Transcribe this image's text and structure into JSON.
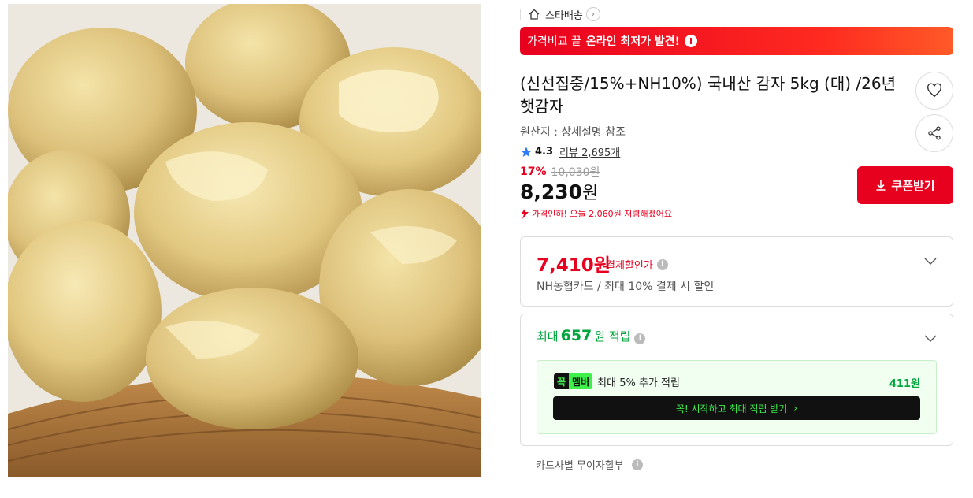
{
  "delivery": {
    "label": "스타배송",
    "chevron": "›"
  },
  "banner": {
    "prefix": "가격비교 끝",
    "highlight": "온라인 최저가 발견!",
    "info": "i"
  },
  "product": {
    "title": "(신선집중/15%+NH10%) 국내산 감자 5kg (대) /26년 햇감자",
    "origin": "원산지 : 상세설명 참조",
    "rating": "4.3",
    "review_text": "리뷰 2,695개",
    "discount_rate": "17%",
    "original_price": "10,030원",
    "price_number": "8,230",
    "price_unit": "원",
    "price_drop": "가격인하! 오늘 2,060원 저렴해졌어요"
  },
  "coupon_button": {
    "label": "쿠폰받기"
  },
  "payment_discount": {
    "price": "7,410원",
    "label": "결제할인가",
    "info": "i",
    "desc": "NH농협카드 / 최대 10% 결제 시 할인"
  },
  "points": {
    "prefix": "최대",
    "amount": "657",
    "suffix": "원 적립",
    "info": "i",
    "member": {
      "badge_a": "꼭",
      "badge_b": "멤버",
      "text": "최대 5% 추가 적립",
      "points": "411원",
      "cta": "꼭! 시작하고 최대 적립 받기",
      "cta_chevron": "›"
    }
  },
  "installment": {
    "label": "카드사별 무이자할부",
    "info": "i"
  },
  "icons": {
    "heart": "heart-icon",
    "share": "share-icon",
    "download": "download-icon",
    "star": "star-icon"
  },
  "colors": {
    "accent": "#e8001f",
    "green": "#00a53d",
    "member_green": "#3df04a"
  }
}
